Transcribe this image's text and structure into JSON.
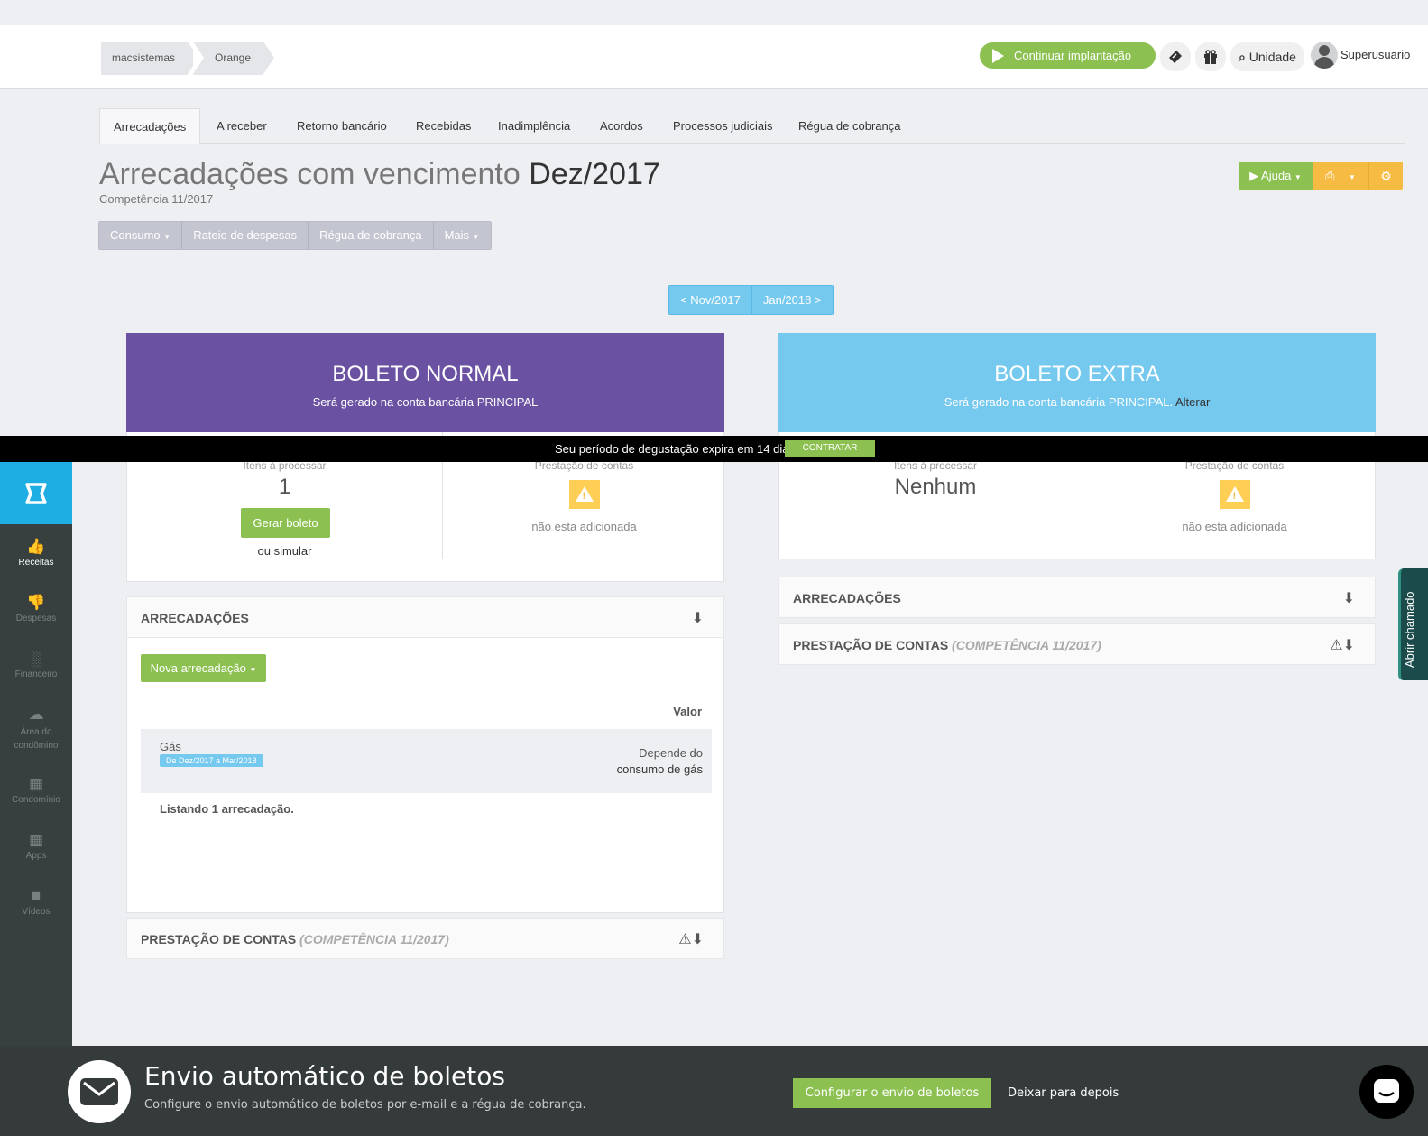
{
  "breadcrumb": [
    "macsistemas",
    "Orange"
  ],
  "header": {
    "continuar_label": "Continuar implantação",
    "unidade_label": "Unidade",
    "user_name": "Superusuario",
    "icons": [
      "ticket-icon",
      "gift-icon",
      "search-icon",
      "avatar"
    ]
  },
  "tabs": [
    "Arrecadações",
    "A receber",
    "Retorno bancário",
    "Recebidas",
    "Inadimplência",
    "Acordos",
    "Processos judiciais",
    "Régua de cobrança"
  ],
  "page": {
    "title_prefix": "Arrecadações com vencimento",
    "title_month": "Dez/2017",
    "competencia": "Competência 11/2017"
  },
  "subnav": [
    "Consumo",
    "Rateio de despesas",
    "Régua de cobrança",
    "Mais"
  ],
  "actions": {
    "ajuda": "Ajuda"
  },
  "monthnav": {
    "prev": "< Nov/2017",
    "next": "Jan/2018 >"
  },
  "boleto_normal": {
    "title": "BOLETO NORMAL",
    "subtitle": "Será gerado na conta bancária PRINCIPAL",
    "itens_label": "Itens à processar",
    "itens_value": "1",
    "gerar_label": "Gerar boleto",
    "simular_label": "ou simular",
    "prestacao_label": "Prestação de contas",
    "prestacao_note": "não esta adicionada"
  },
  "boleto_extra": {
    "title": "BOLETO EXTRA",
    "subtitle": "Será gerado na conta bancária PRINCIPAL.",
    "alterar": "Alterar",
    "itens_label": "Itens à processar",
    "itens_value": "Nenhum",
    "prestacao_label": "Prestação de contas",
    "prestacao_note": "não esta adicionada"
  },
  "banner": {
    "text": "Seu período de degustação expira em 14 dias",
    "button": "CONTRATAR"
  },
  "arrecadacoes": {
    "title": "ARRECADAÇÕES",
    "nova_label": "Nova arrecadação",
    "valor_header": "Valor",
    "rows": [
      {
        "name": "Gás",
        "badge": "De Dez/2017 a Mar/2018",
        "value_line1": "Depende do",
        "value_line2": "consumo de gás"
      }
    ],
    "footer": "Listando 1 arrecadação."
  },
  "prestacao": {
    "title": "PRESTAÇÃO DE CONTAS",
    "comp": "(COMPETÊNCIA 11/2017)"
  },
  "sidebar": [
    {
      "label": "Receitas",
      "icon": "thumbs-up-icon"
    },
    {
      "label": "Despesas",
      "icon": "thumbs-down-icon"
    },
    {
      "label": "Financeiro",
      "icon": "bar-chart-icon"
    },
    {
      "label": "Área do condômino",
      "icon": "cloud-icon"
    },
    {
      "label": "Condomínio",
      "icon": "building-icon"
    },
    {
      "label": "Apps",
      "icon": "puzzle-icon"
    },
    {
      "label": "Vídeos",
      "icon": "video-camera-icon"
    }
  ],
  "abrir_chamado": "Abrir chamado",
  "envio": {
    "title": "Envio automático de boletos",
    "subtitle": "Configure o envio automático de boletos por e-mail e a régua de cobrança.",
    "config_label": "Configurar o envio de boletos",
    "later_label": "Deixar para depois"
  },
  "colors": {
    "green": "#8cc152",
    "yellow": "#f6bb42",
    "purple": "#6a51a2",
    "blue": "#75c8ee",
    "sidebar": "#373f3f"
  }
}
